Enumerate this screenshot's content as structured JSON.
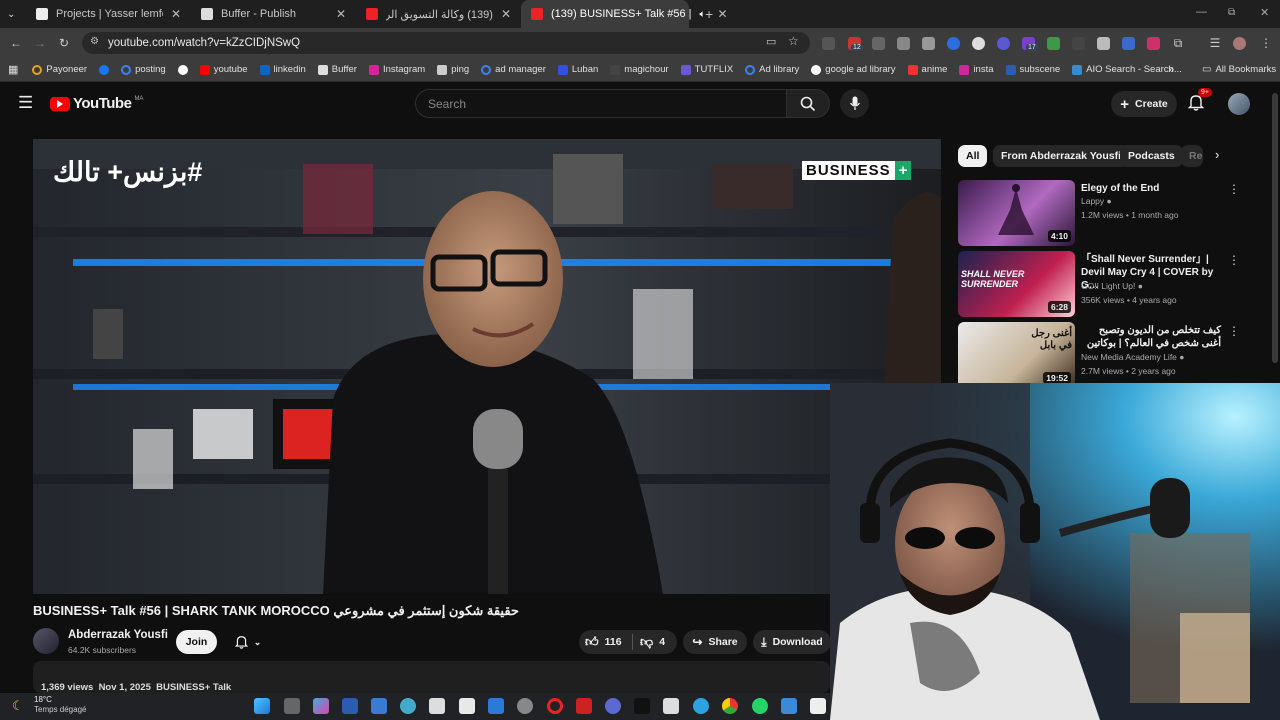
{
  "browser": {
    "tabs": [
      {
        "title": "Projects | Yasser lemfeddel's W…",
        "active": false
      },
      {
        "title": "Buffer - Publish",
        "active": false
      },
      {
        "title": "(139) وكالة التسويق الرقمي كيف…",
        "active": false
      },
      {
        "title": "(139) BUSINESS+ Talk #56 |",
        "active": true
      }
    ],
    "url": "youtube.com/watch?v=kZzCIDjNSwQ",
    "new_tab_label": "+",
    "extension_badges": {
      "ext1": "12",
      "ext2": "17"
    },
    "bookmarks": [
      "Payoneer",
      "",
      "posting",
      "",
      "youtube",
      "linkedin",
      "Buffer",
      "Instagram",
      "ping",
      "ad manager",
      "Luban",
      "magichour",
      "TUTFLIX",
      "Ad library",
      "google ad library",
      "anime",
      "insta",
      "subscene",
      "AIO Search - Search..."
    ],
    "all_bookmarks": "All Bookmarks"
  },
  "youtube": {
    "logo_text": "YouTube",
    "logo_region": "MA",
    "search_placeholder": "Search",
    "create_label": "Create",
    "notification_badge": "9+",
    "video_overlay_left": "#بزنس+ تالك",
    "video_overlay_right": "BUSINESS",
    "video_title": "BUSINESS+ Talk #56 | SHARK TANK MOROCCO حقيقة شكون إستثمر في مشروعي",
    "channel": {
      "name": "Abderrazak Yousfi",
      "subscribers": "64.2K subscribers",
      "join_label": "Join"
    },
    "actions": {
      "likes": "116",
      "dislikes": "4",
      "share": "Share",
      "download": "Download"
    },
    "description_peek": "1,369 views  Nov 1, 2025  BUSINESS+ Talk",
    "chips": [
      "All",
      "From Abderrazak Yousfi",
      "Podcasts",
      "Re"
    ],
    "recommendations": [
      {
        "title": "Elegy of the End",
        "channel": "Lappy",
        "meta": "1.2M views • 1 month ago",
        "duration": "4:10"
      },
      {
        "title": "「Shall Never Surrender」| Devil May Cry 4 | COVER by G…",
        "channel": "GO!! Light Up!",
        "meta": "356K views • 4 years ago",
        "duration": "6:28"
      },
      {
        "title": "كيف تتخلص من الديون وتصبح أغنى شخص في العالم؟ | بوكاتين",
        "channel": "New Media Academy Life",
        "meta": "2.7M views • 2 years ago",
        "duration": "19:52"
      }
    ],
    "rec_thumb_text": [
      "SHALL NEVER SURRENDER",
      "أغنى رجل في بابل"
    ]
  },
  "taskbar": {
    "temperature": "18°C",
    "weather": "Temps dégagé"
  },
  "colors": {
    "yt_red": "#ff0000",
    "bg": "#0f0f0f",
    "chrome_dark": "#3c3c3c"
  }
}
